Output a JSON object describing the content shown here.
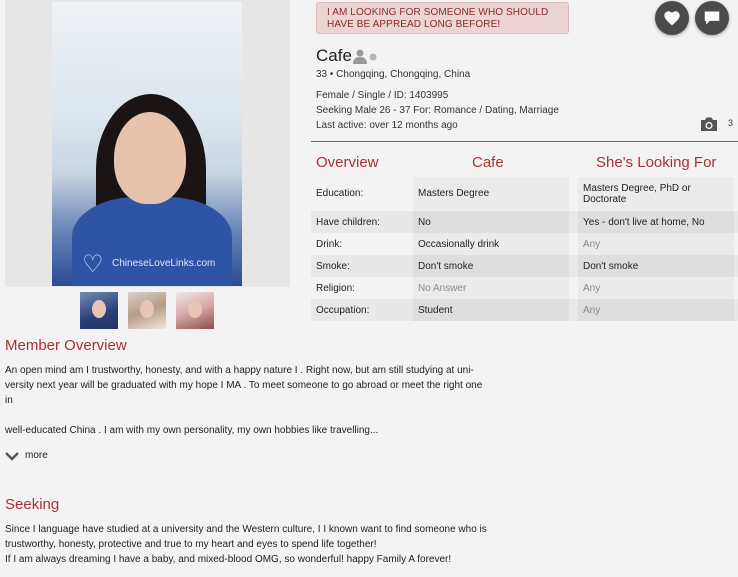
{
  "banner": "I AM LOOKING FOR SOMEONE WHO SHOULD HAVE BE APPREAD LONG BEFORE!",
  "watermark": "ChineseLoveLinks.com",
  "profile": {
    "name": "Cafe",
    "location": "33 • Chongqing, Chongqing, China",
    "status": "Female / Single / ID: 1403995",
    "seeking": "Seeking Male 26 - 37 For: Romance / Dating, Marriage",
    "last_active": "Last active: over 12 months ago",
    "photo_count": "3"
  },
  "table": {
    "headers": [
      "Overview",
      "Cafe",
      "She's Looking For"
    ],
    "rows": [
      {
        "label": "Education:",
        "her": "Masters Degree",
        "want": "Masters Degree, PhD or Doctorate"
      },
      {
        "label": "Have children:",
        "her": "No",
        "want": "Yes - don't live at home, No"
      },
      {
        "label": "Drink:",
        "her": "Occasionally drink",
        "want": "Any"
      },
      {
        "label": "Smoke:",
        "her": "Don't smoke",
        "want": "Don't smoke"
      },
      {
        "label": "Religion:",
        "her": "No Answer",
        "want": "Any"
      },
      {
        "label": "Occupation:",
        "her": "Student",
        "want": "Any"
      }
    ]
  },
  "overview": {
    "title": "Member Overview",
    "line1": "An open mind am I trustworthy, honesty, and with a happy nature I . Right now, but am still studying at uni-",
    "line2": "versity next year will be graduated with my hope I MA . To meet someone to go abroad or meet the right one",
    "line3": "in",
    "line4": "well-educated China . I am with my own personality, my own hobbies like travelling...",
    "more": "more"
  },
  "seeking_section": {
    "title": "Seeking",
    "line1": "Since I language have studied at a university and the Western culture, I I known want to find someone who is",
    "line2": "trustworthy, honesty, protective and true to my heart and eyes to spend life together!",
    "line3": "If I am always dreaming I have a baby, and mixed-blood OMG, so wonderful! happy Family A forever!"
  },
  "colors": {
    "accent": "#a83232",
    "banner_bg": "#ebd4d4",
    "button_bg": "#4a4a4a"
  }
}
